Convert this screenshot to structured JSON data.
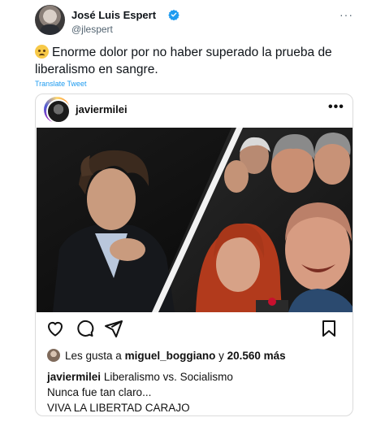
{
  "tweet": {
    "author_name": "José Luis Espert",
    "author_handle": "@jlespert",
    "text": "Enorme dolor por no haber superado la prueba de liberalismo en sangre.",
    "emoji": "crying-face-emoji",
    "translate_label": "Translate Tweet",
    "more_label": "···"
  },
  "instagram_embed": {
    "username": "javiermilei",
    "more_label": "•••",
    "likes": {
      "prefix": "Les gusta a",
      "user": "miguel_boggiano",
      "connector": "y",
      "count": "20.560 más"
    },
    "caption": {
      "username": "javiermilei",
      "line1": "Liberalismo vs. Socialismo",
      "line2": "Nunca fue tan claro...",
      "line3": "VIVA LA LIBERTAD CARAJO"
    },
    "actions": [
      "heart-icon",
      "comment-icon",
      "share-icon",
      "bookmark-icon"
    ]
  },
  "colors": {
    "link_blue": "#1d9bf0",
    "verified_blue": "#1d9bf0",
    "secondary_text": "#536471",
    "card_border": "#dbdbdb"
  }
}
